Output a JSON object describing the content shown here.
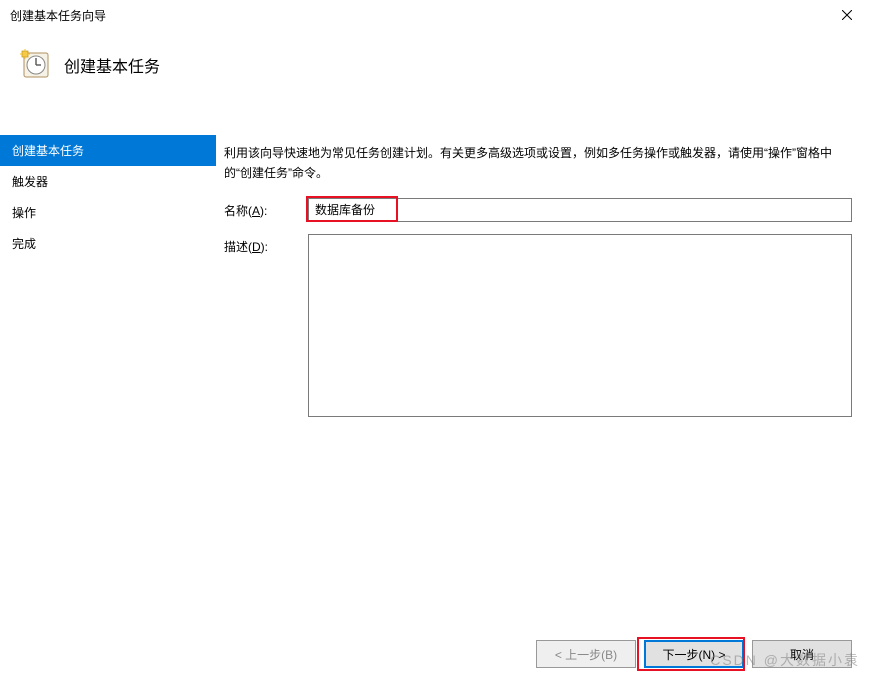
{
  "window": {
    "title": "创建基本任务向导"
  },
  "header": {
    "title": "创建基本任务"
  },
  "nav": {
    "items": [
      {
        "label": "创建基本任务",
        "selected": true
      },
      {
        "label": "触发器",
        "selected": false
      },
      {
        "label": "操作",
        "selected": false
      },
      {
        "label": "完成",
        "selected": false
      }
    ]
  },
  "pane": {
    "intro": "利用该向导快速地为常见任务创建计划。有关更多高级选项或设置，例如多任务操作或触发器，请使用“操作”窗格中的“创建任务”命令。",
    "name_label_prefix": "名称(",
    "name_label_key": "A",
    "name_label_suffix": "):",
    "name_value": "数据库备份",
    "desc_label_prefix": "描述(",
    "desc_label_key": "D",
    "desc_label_suffix": "):",
    "desc_value": ""
  },
  "buttons": {
    "back": "< 上一步(B)",
    "next": "下一步(N) >",
    "cancel": "取消"
  },
  "watermark": "CSDN @大数据小袁"
}
